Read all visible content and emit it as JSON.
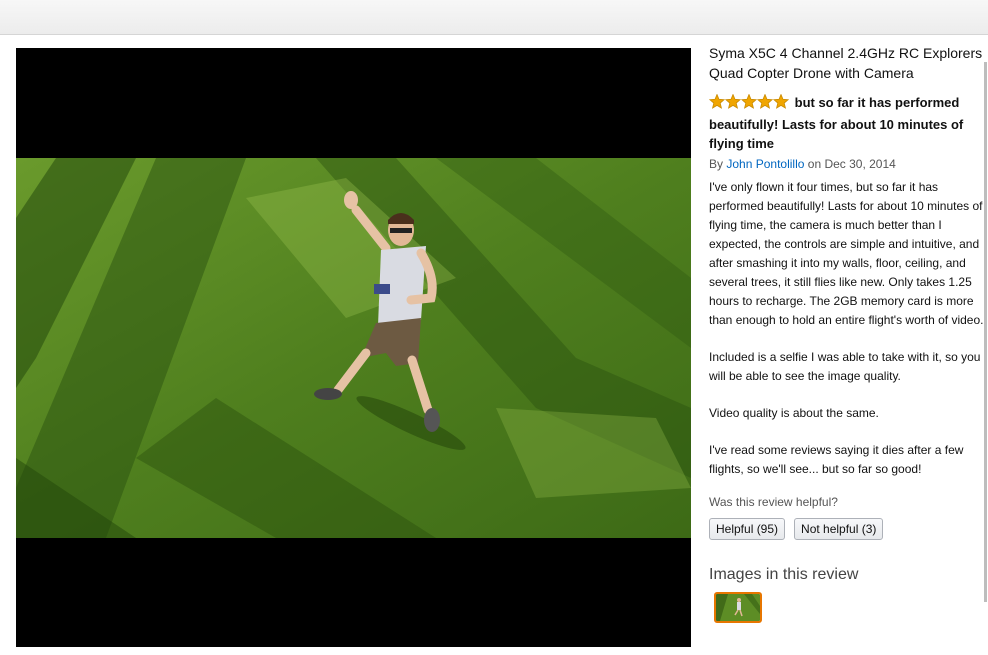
{
  "product": {
    "title": "Syma X5C 4 Channel 2.4GHz RC Explorers Quad Copter Drone with Camera"
  },
  "review": {
    "rating": 5,
    "rating_max": 5,
    "headline": "but so far it has performed beautifully! Lasts for about 10 minutes of flying time",
    "by_prefix": "By",
    "author": "John Pontolillo",
    "date": "on Dec 30, 2014",
    "paragraphs": [
      "I've only flown it four times, but so far it has performed beautifully! Lasts for about 10 minutes of flying time, the camera is much better than I expected, the controls are simple and intuitive, and after smashing it into my walls, floor, ceiling, and several trees, it still flies like new. Only takes 1.25 hours to recharge. The 2GB memory card is more than enough to hold an entire flight's worth of video.",
      "Included is a selfie I was able to take with it, so you will be able to see the image quality.",
      "Video quality is about the same.",
      "I've read some reviews saying it dies after a few flights, so we'll see... but so far so good!"
    ],
    "helpful_question": "Was this review helpful?",
    "helpful_button": "Helpful (95)",
    "not_helpful_button": "Not helpful (3)"
  },
  "images_section": {
    "heading": "Images in this review"
  },
  "colors": {
    "star": "#f0a500",
    "link": "#0066c0",
    "thumb_border": "#e77600",
    "viewer_bg": "#000000"
  }
}
